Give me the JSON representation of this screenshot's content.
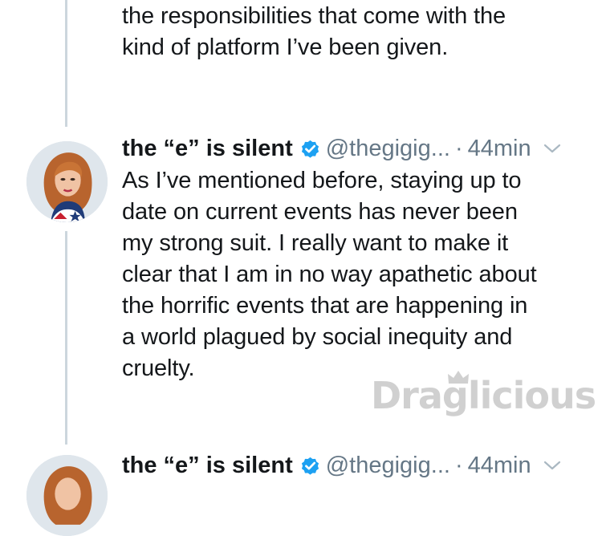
{
  "previous_tweet": {
    "text_lines": "the responsibilities that come with the\nkind of platform I’ve been given."
  },
  "tweet": {
    "display_name": "the “e” is silent",
    "handle": "@thegigig...",
    "separator": "·",
    "time": "44min",
    "text": "As I’ve mentioned before, staying up to\ndate on current events has never been\nmy strong suit. I really want to make it\nclear that I am in no way apathetic about\nthe horrific events that are happening in\na world plagued by social inequity and\ncruelty."
  },
  "next_tweet": {
    "display_name": "the “e” is silent",
    "handle": "@thegigig...",
    "separator": "·",
    "time": "44min"
  },
  "watermark": {
    "text": "Draglicious"
  },
  "icons": {
    "verified": "verified-badge-icon",
    "caret": "chevron-down-icon"
  },
  "colors": {
    "verified_blue": "#1da1f2",
    "meta_gray": "#657786",
    "thread_line": "#ccd6dd"
  }
}
